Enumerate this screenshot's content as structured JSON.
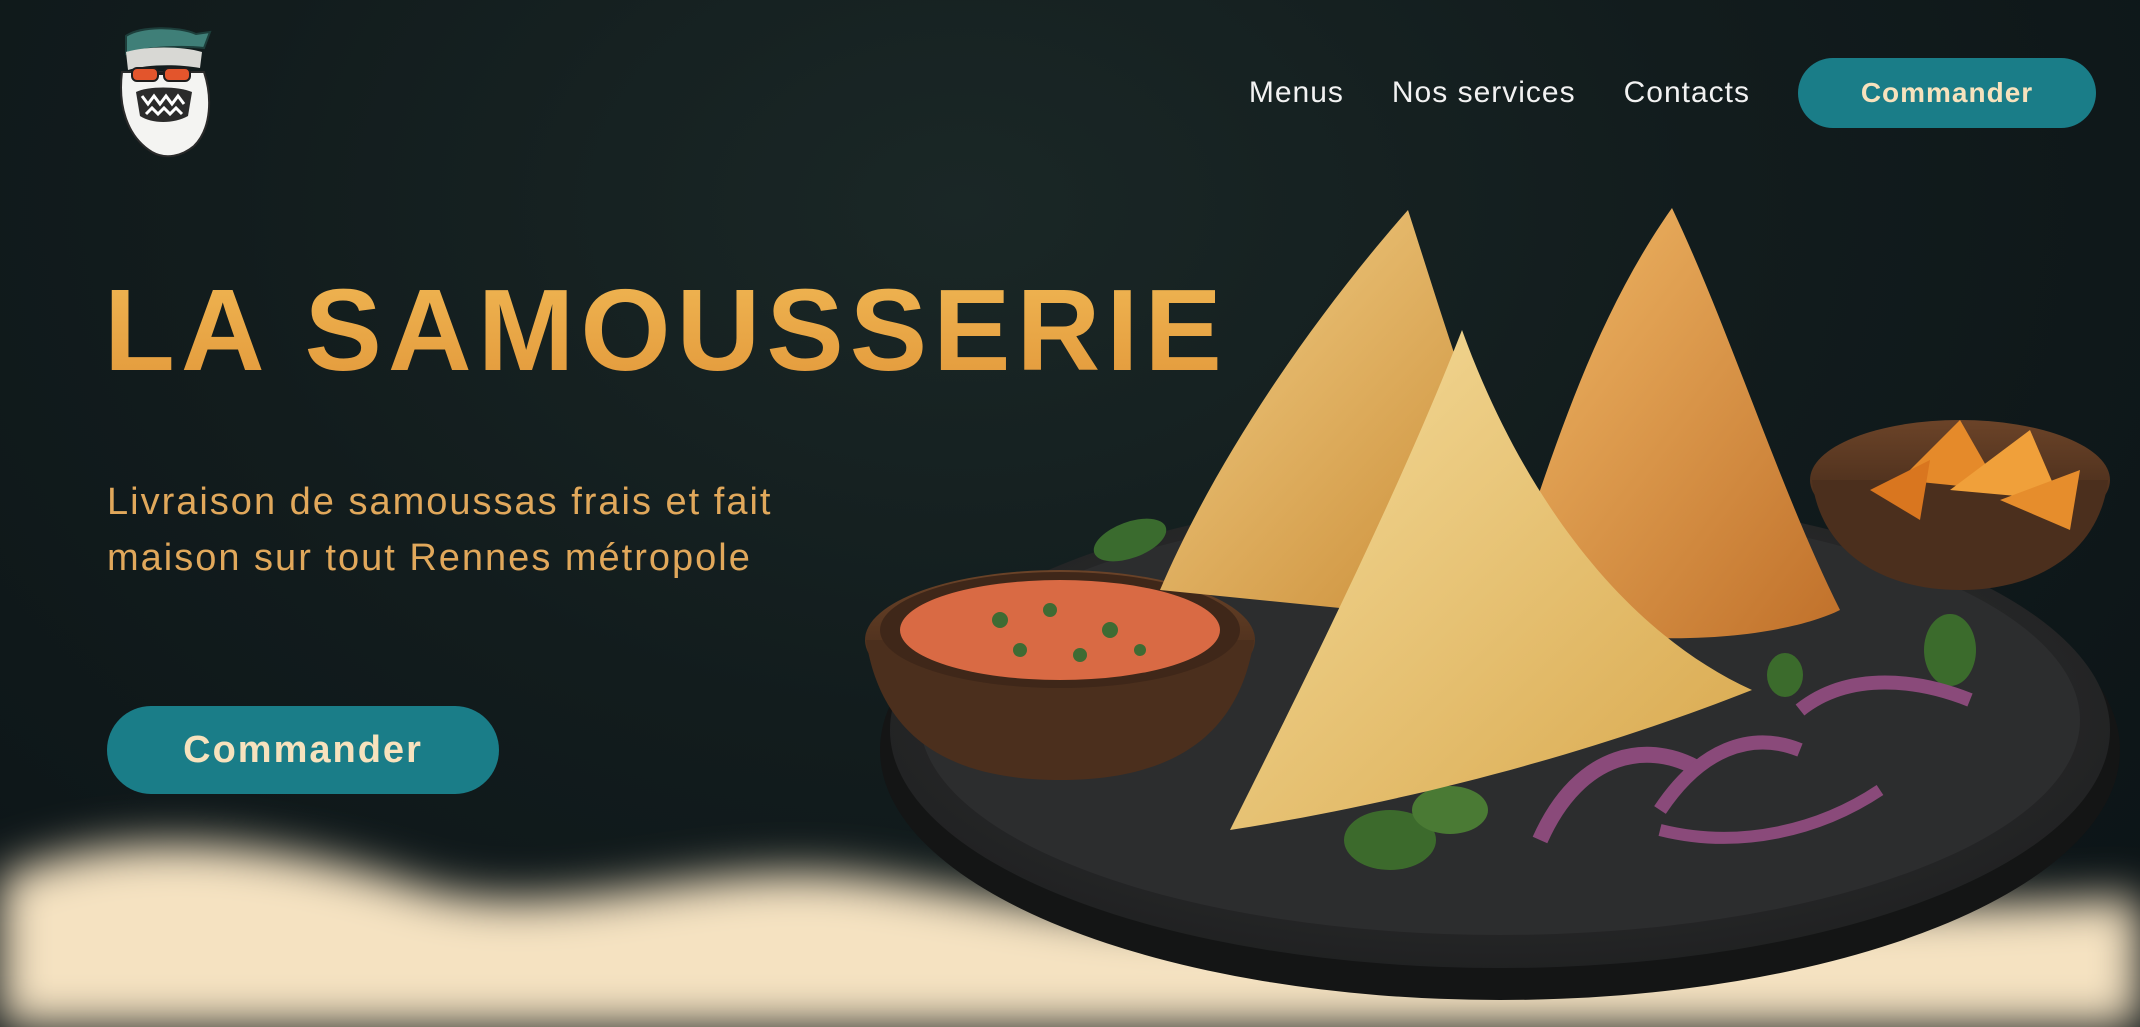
{
  "brand": {
    "logo_icon": "gorilla-mascot-icon"
  },
  "nav": {
    "items": [
      {
        "label": "Menus"
      },
      {
        "label": "Nos services"
      },
      {
        "label": "Contacts"
      }
    ],
    "cta_label": "Commander"
  },
  "hero": {
    "title": "LA SAMOUSSERIE",
    "subtitle": "Livraison de samoussas frais et fait maison sur tout Rennes métropole",
    "cta_label": "Commander",
    "image_icon": "samosa-plate-illustration"
  },
  "colors": {
    "background": "#121c1d",
    "accent_teal": "#1a7d88",
    "title_orange": "#e9a446",
    "button_text": "#f7e2bd",
    "cream_wave": "#f5e2c1"
  }
}
